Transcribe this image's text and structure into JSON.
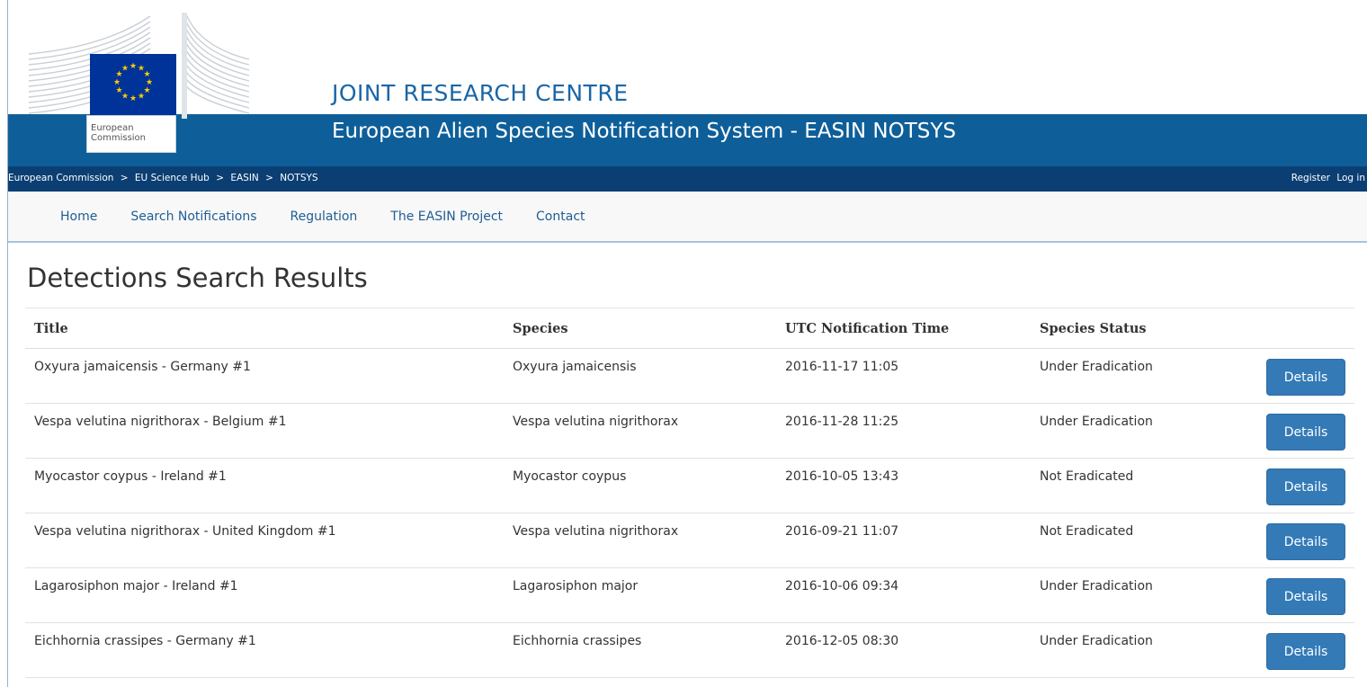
{
  "header": {
    "org_name": "JOINT RESEARCH CENTRE",
    "site_title": "European Alien Species Notification System - EASIN NOTSYS",
    "logo": {
      "line1": "European",
      "line2": "Commission",
      "flag_color": "#003399",
      "star_color": "#ffcc00"
    },
    "colors": {
      "banner": "#0e5f99",
      "breadcrumb_bar": "#0b3f73",
      "title_blue": "#1a66a6"
    }
  },
  "breadcrumb": {
    "items": [
      "European Commission",
      "EU Science Hub",
      "EASIN",
      "NOTSYS"
    ],
    "separator": ">"
  },
  "auth": {
    "register": "Register",
    "login": "Log in"
  },
  "nav": {
    "items": [
      "Home",
      "Search Notifications",
      "Regulation",
      "The EASIN Project",
      "Contact"
    ]
  },
  "main": {
    "title": "Detections Search Results",
    "columns": [
      "Title",
      "Species",
      "UTC Notification Time",
      "Species Status"
    ],
    "button_label": "Details",
    "button_color": "#337ab7",
    "rows": [
      {
        "title": "Oxyura jamaicensis - Germany #1",
        "species": "Oxyura jamaicensis",
        "time": "2016-11-17 11:05",
        "status": "Under Eradication"
      },
      {
        "title": "Vespa velutina nigrithorax - Belgium #1",
        "species": "Vespa velutina nigrithorax",
        "time": "2016-11-28 11:25",
        "status": "Under Eradication"
      },
      {
        "title": "Myocastor coypus - Ireland #1",
        "species": "Myocastor coypus",
        "time": "2016-10-05 13:43",
        "status": "Not Eradicated"
      },
      {
        "title": "Vespa velutina nigrithorax - United Kingdom #1",
        "species": "Vespa velutina nigrithorax",
        "time": "2016-09-21 11:07",
        "status": "Not Eradicated"
      },
      {
        "title": "Lagarosiphon major - Ireland #1",
        "species": "Lagarosiphon major",
        "time": "2016-10-06 09:34",
        "status": "Under Eradication"
      },
      {
        "title": "Eichhornia crassipes - Germany #1",
        "species": "Eichhornia crassipes",
        "time": "2016-12-05 08:30",
        "status": "Under Eradication"
      }
    ]
  }
}
